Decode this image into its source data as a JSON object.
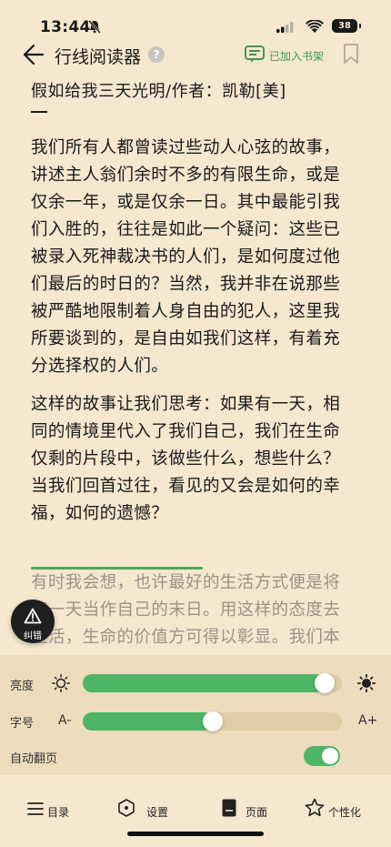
{
  "status_bar": {
    "time": "13:44",
    "battery": "38"
  },
  "nav": {
    "title": "行线阅读器",
    "help": "?",
    "shelf_label": "已加入书架"
  },
  "content": {
    "book_title": "假如给我三天光明/作者：凯勒[美]",
    "paragraph1": [
      "我们所有人都曾读过些动人心弦的故事，",
      "讲述主人翁们余时不多的有限生命，或是",
      "仅余一年，或是仅余一日。其中最能引我",
      "们入胜的，往往是如此一个疑问：这些已",
      "被录入死神裁决书的人们，是如何度过他",
      "们最后的时日的？当然，我并非在说那些",
      "被严酷地限制着人身自由的犯人，这里我",
      "所要谈到的，是自由如我们这样，有着充",
      "分选择权的人们。"
    ],
    "paragraph2": [
      "这样的故事让我们思考：如果有一天，相",
      "同的情境里代入了我们自己，我们在生命",
      "仅剩的片段中，该做些什么，想些什么？",
      "当我们回首过往，看见的又会是如何的幸",
      "福，如何的遗憾？"
    ],
    "paragraph3": [
      "有时我会想，也许最好的生活方式便是将",
      "每一天当作自己的末日。用这样的态度去",
      "生活，生命的价值方可得以彰显。我们本"
    ]
  },
  "fix_button": {
    "label": "纠错"
  },
  "settings": {
    "brightness_label": "亮度",
    "brightness_level": 0.97,
    "font_label": "字号",
    "font_decrease": "A-",
    "font_increase": "A+",
    "font_level": 0.5,
    "auto_page_label": "自动翻页",
    "auto_page_on": true
  },
  "tabs": [
    {
      "label": "目录",
      "icon": "list-icon"
    },
    {
      "label": "设置",
      "icon": "hexagon-settings-icon"
    },
    {
      "label": "页面",
      "icon": "page-icon"
    },
    {
      "label": "个性化",
      "icon": "star-icon"
    }
  ],
  "colors": {
    "background": "#f5e8cf",
    "panel": "#eddcbd",
    "accent": "#4db565",
    "track": "#e0cda8",
    "faded_text": "#9a9386"
  }
}
